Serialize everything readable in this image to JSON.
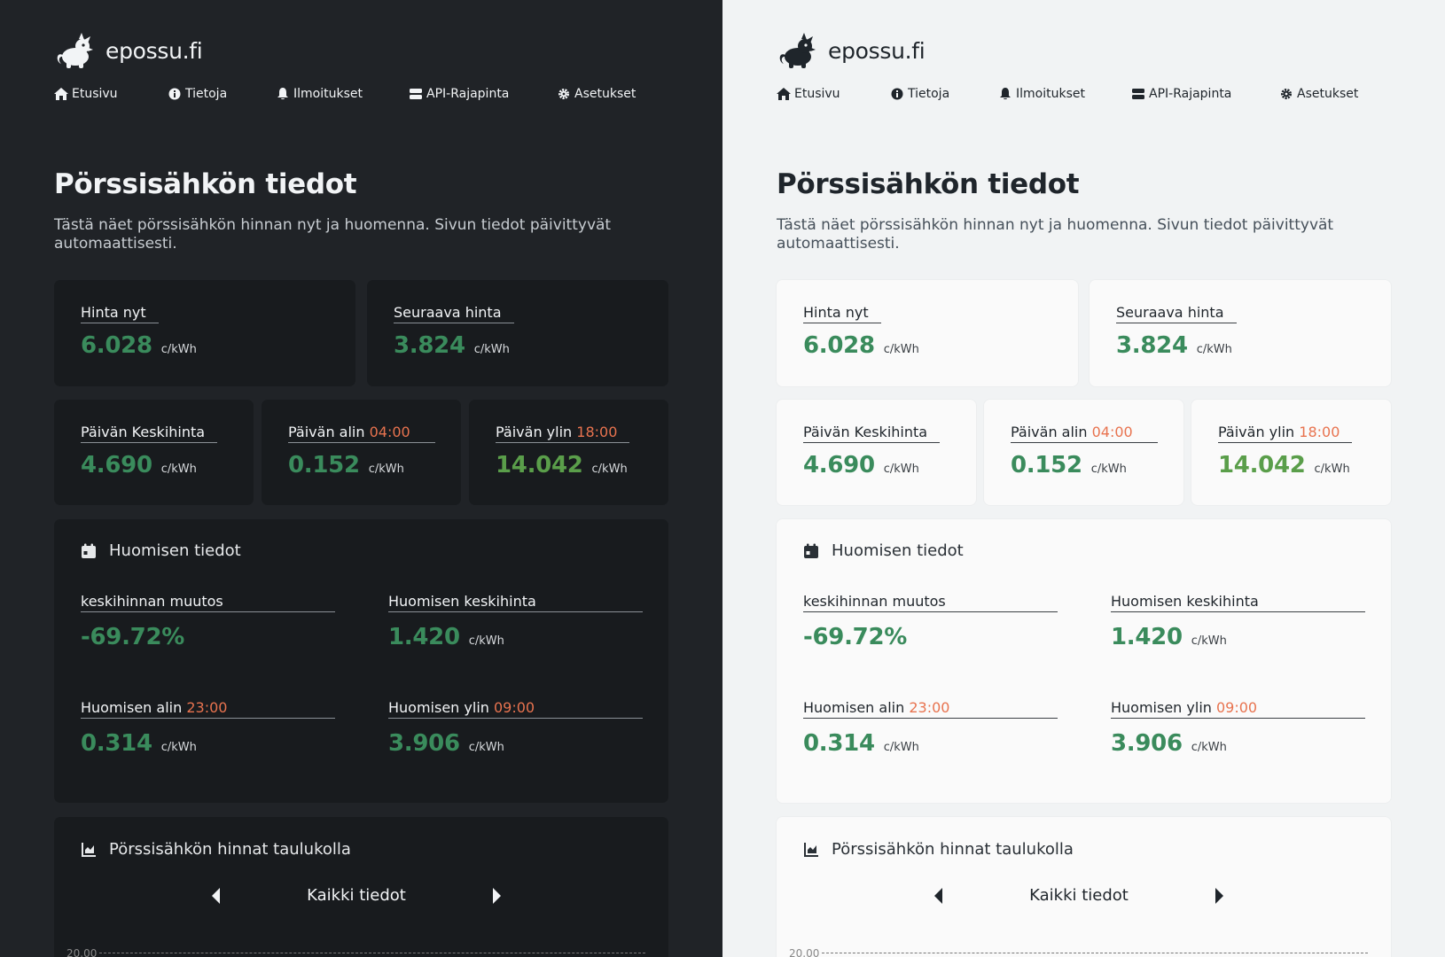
{
  "brand": {
    "name": "epossu.fi"
  },
  "nav": [
    {
      "label": "Etusivu",
      "icon": "home-icon"
    },
    {
      "label": "Tietoja",
      "icon": "info-icon"
    },
    {
      "label": "Ilmoitukset",
      "icon": "bell-icon"
    },
    {
      "label": "API-Rajapinta",
      "icon": "server-icon"
    },
    {
      "label": "Asetukset",
      "icon": "gear-icon"
    }
  ],
  "page": {
    "title": "Pörssisähkön tiedot",
    "intro": "Tästä näet pörssisähkön hinnan nyt ja huomenna. Sivun tiedot päivittyvät automaattisesti."
  },
  "unit": "c/kWh",
  "current": {
    "now": {
      "label": "Hinta nyt",
      "value": "6.028"
    },
    "next": {
      "label": "Seuraava hinta",
      "value": "3.824"
    }
  },
  "today": {
    "average": {
      "label": "Päivän Keskihinta",
      "value": "4.690"
    },
    "min": {
      "label": "Päivän alin",
      "time": "04:00",
      "value": "0.152"
    },
    "max": {
      "label": "Päivän ylin",
      "time": "18:00",
      "value": "14.042"
    }
  },
  "tomorrow": {
    "heading": "Huomisen tiedot",
    "change": {
      "label": "keskihinnan muutos",
      "value": "-69.72%"
    },
    "average": {
      "label": "Huomisen keskihinta",
      "value": "1.420"
    },
    "min": {
      "label": "Huomisen alin",
      "time": "23:00",
      "value": "0.314"
    },
    "max": {
      "label": "Huomisen ylin",
      "time": "09:00",
      "value": "3.906"
    }
  },
  "table_section": {
    "heading": "Pörssisähkön hinnat taulukolla",
    "range_label": "Kaikki tiedot",
    "first_tick": "20.00"
  },
  "colors": {
    "dark_bg": "#202327",
    "dark_card": "#181b1e",
    "light_bg": "#f1f3f4",
    "light_card": "#fafafa",
    "price_green": "#3a8b5c",
    "price_high": "#5a9e4a",
    "time_accent": "#e8734f"
  }
}
